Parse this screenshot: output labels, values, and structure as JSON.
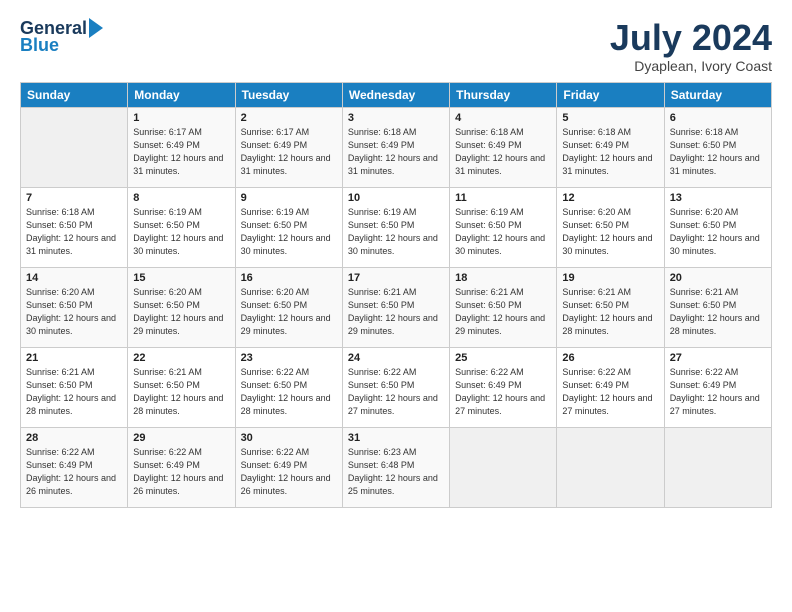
{
  "logo": {
    "general": "General",
    "blue": "Blue"
  },
  "header": {
    "month": "July 2024",
    "location": "Dyaplean, Ivory Coast"
  },
  "weekdays": [
    "Sunday",
    "Monday",
    "Tuesday",
    "Wednesday",
    "Thursday",
    "Friday",
    "Saturday"
  ],
  "weeks": [
    [
      {
        "day": "",
        "sunrise": "",
        "sunset": "",
        "daylight": ""
      },
      {
        "day": "1",
        "sunrise": "Sunrise: 6:17 AM",
        "sunset": "Sunset: 6:49 PM",
        "daylight": "Daylight: 12 hours and 31 minutes."
      },
      {
        "day": "2",
        "sunrise": "Sunrise: 6:17 AM",
        "sunset": "Sunset: 6:49 PM",
        "daylight": "Daylight: 12 hours and 31 minutes."
      },
      {
        "day": "3",
        "sunrise": "Sunrise: 6:18 AM",
        "sunset": "Sunset: 6:49 PM",
        "daylight": "Daylight: 12 hours and 31 minutes."
      },
      {
        "day": "4",
        "sunrise": "Sunrise: 6:18 AM",
        "sunset": "Sunset: 6:49 PM",
        "daylight": "Daylight: 12 hours and 31 minutes."
      },
      {
        "day": "5",
        "sunrise": "Sunrise: 6:18 AM",
        "sunset": "Sunset: 6:49 PM",
        "daylight": "Daylight: 12 hours and 31 minutes."
      },
      {
        "day": "6",
        "sunrise": "Sunrise: 6:18 AM",
        "sunset": "Sunset: 6:50 PM",
        "daylight": "Daylight: 12 hours and 31 minutes."
      }
    ],
    [
      {
        "day": "7",
        "sunrise": "Sunrise: 6:18 AM",
        "sunset": "Sunset: 6:50 PM",
        "daylight": "Daylight: 12 hours and 31 minutes."
      },
      {
        "day": "8",
        "sunrise": "Sunrise: 6:19 AM",
        "sunset": "Sunset: 6:50 PM",
        "daylight": "Daylight: 12 hours and 30 minutes."
      },
      {
        "day": "9",
        "sunrise": "Sunrise: 6:19 AM",
        "sunset": "Sunset: 6:50 PM",
        "daylight": "Daylight: 12 hours and 30 minutes."
      },
      {
        "day": "10",
        "sunrise": "Sunrise: 6:19 AM",
        "sunset": "Sunset: 6:50 PM",
        "daylight": "Daylight: 12 hours and 30 minutes."
      },
      {
        "day": "11",
        "sunrise": "Sunrise: 6:19 AM",
        "sunset": "Sunset: 6:50 PM",
        "daylight": "Daylight: 12 hours and 30 minutes."
      },
      {
        "day": "12",
        "sunrise": "Sunrise: 6:20 AM",
        "sunset": "Sunset: 6:50 PM",
        "daylight": "Daylight: 12 hours and 30 minutes."
      },
      {
        "day": "13",
        "sunrise": "Sunrise: 6:20 AM",
        "sunset": "Sunset: 6:50 PM",
        "daylight": "Daylight: 12 hours and 30 minutes."
      }
    ],
    [
      {
        "day": "14",
        "sunrise": "Sunrise: 6:20 AM",
        "sunset": "Sunset: 6:50 PM",
        "daylight": "Daylight: 12 hours and 30 minutes."
      },
      {
        "day": "15",
        "sunrise": "Sunrise: 6:20 AM",
        "sunset": "Sunset: 6:50 PM",
        "daylight": "Daylight: 12 hours and 29 minutes."
      },
      {
        "day": "16",
        "sunrise": "Sunrise: 6:20 AM",
        "sunset": "Sunset: 6:50 PM",
        "daylight": "Daylight: 12 hours and 29 minutes."
      },
      {
        "day": "17",
        "sunrise": "Sunrise: 6:21 AM",
        "sunset": "Sunset: 6:50 PM",
        "daylight": "Daylight: 12 hours and 29 minutes."
      },
      {
        "day": "18",
        "sunrise": "Sunrise: 6:21 AM",
        "sunset": "Sunset: 6:50 PM",
        "daylight": "Daylight: 12 hours and 29 minutes."
      },
      {
        "day": "19",
        "sunrise": "Sunrise: 6:21 AM",
        "sunset": "Sunset: 6:50 PM",
        "daylight": "Daylight: 12 hours and 28 minutes."
      },
      {
        "day": "20",
        "sunrise": "Sunrise: 6:21 AM",
        "sunset": "Sunset: 6:50 PM",
        "daylight": "Daylight: 12 hours and 28 minutes."
      }
    ],
    [
      {
        "day": "21",
        "sunrise": "Sunrise: 6:21 AM",
        "sunset": "Sunset: 6:50 PM",
        "daylight": "Daylight: 12 hours and 28 minutes."
      },
      {
        "day": "22",
        "sunrise": "Sunrise: 6:21 AM",
        "sunset": "Sunset: 6:50 PM",
        "daylight": "Daylight: 12 hours and 28 minutes."
      },
      {
        "day": "23",
        "sunrise": "Sunrise: 6:22 AM",
        "sunset": "Sunset: 6:50 PM",
        "daylight": "Daylight: 12 hours and 28 minutes."
      },
      {
        "day": "24",
        "sunrise": "Sunrise: 6:22 AM",
        "sunset": "Sunset: 6:50 PM",
        "daylight": "Daylight: 12 hours and 27 minutes."
      },
      {
        "day": "25",
        "sunrise": "Sunrise: 6:22 AM",
        "sunset": "Sunset: 6:49 PM",
        "daylight": "Daylight: 12 hours and 27 minutes."
      },
      {
        "day": "26",
        "sunrise": "Sunrise: 6:22 AM",
        "sunset": "Sunset: 6:49 PM",
        "daylight": "Daylight: 12 hours and 27 minutes."
      },
      {
        "day": "27",
        "sunrise": "Sunrise: 6:22 AM",
        "sunset": "Sunset: 6:49 PM",
        "daylight": "Daylight: 12 hours and 27 minutes."
      }
    ],
    [
      {
        "day": "28",
        "sunrise": "Sunrise: 6:22 AM",
        "sunset": "Sunset: 6:49 PM",
        "daylight": "Daylight: 12 hours and 26 minutes."
      },
      {
        "day": "29",
        "sunrise": "Sunrise: 6:22 AM",
        "sunset": "Sunset: 6:49 PM",
        "daylight": "Daylight: 12 hours and 26 minutes."
      },
      {
        "day": "30",
        "sunrise": "Sunrise: 6:22 AM",
        "sunset": "Sunset: 6:49 PM",
        "daylight": "Daylight: 12 hours and 26 minutes."
      },
      {
        "day": "31",
        "sunrise": "Sunrise: 6:23 AM",
        "sunset": "Sunset: 6:48 PM",
        "daylight": "Daylight: 12 hours and 25 minutes."
      },
      {
        "day": "",
        "sunrise": "",
        "sunset": "",
        "daylight": ""
      },
      {
        "day": "",
        "sunrise": "",
        "sunset": "",
        "daylight": ""
      },
      {
        "day": "",
        "sunrise": "",
        "sunset": "",
        "daylight": ""
      }
    ]
  ]
}
